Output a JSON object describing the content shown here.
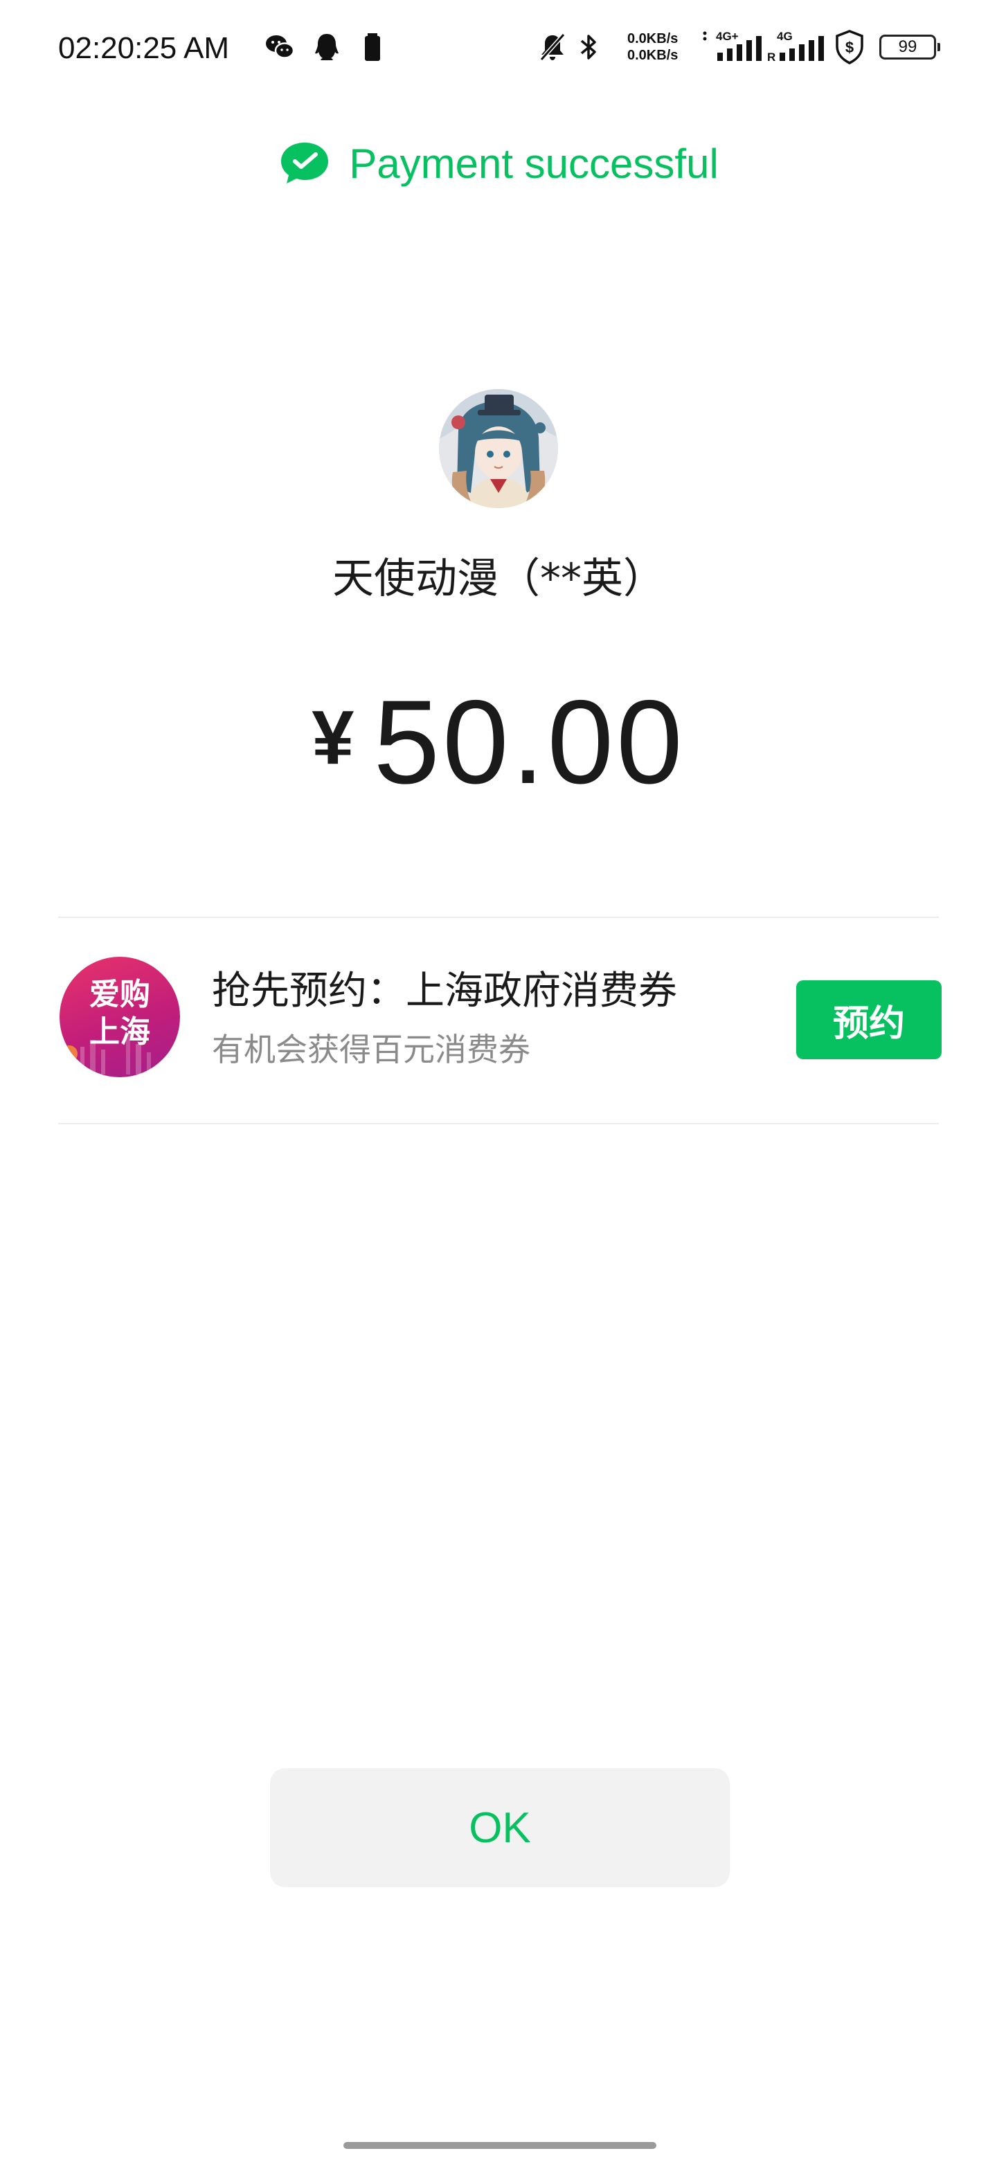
{
  "status_bar": {
    "time": "02:20:25 AM",
    "net_up": "0.0KB/s",
    "net_down": "0.0KB/s",
    "signal1_label": "4G+",
    "signal2_label": "4G",
    "signal2_sub": "R",
    "battery_level": "99",
    "icons": [
      "wechat-icon",
      "qq-icon",
      "battery-saver-icon",
      "mute-icon",
      "bluetooth-icon",
      "signal-icon",
      "shield-icon",
      "battery-icon"
    ]
  },
  "header": {
    "title": "Payment successful"
  },
  "merchant": {
    "name": "天使动漫（**英）"
  },
  "payment": {
    "currency_symbol": "¥",
    "amount": "50.00"
  },
  "promo": {
    "logo_line1": "爱购",
    "logo_line2": "上海",
    "title": "抢先预约：上海政府消费券",
    "subtitle": "有机会获得百元消费券",
    "button_label": "预约"
  },
  "actions": {
    "ok_label": "OK"
  },
  "colors": {
    "accent": "#07c160",
    "promo_gradient_start": "#e8336b",
    "promo_gradient_end": "#a51f8a",
    "ok_button_bg": "#f2f2f2"
  }
}
